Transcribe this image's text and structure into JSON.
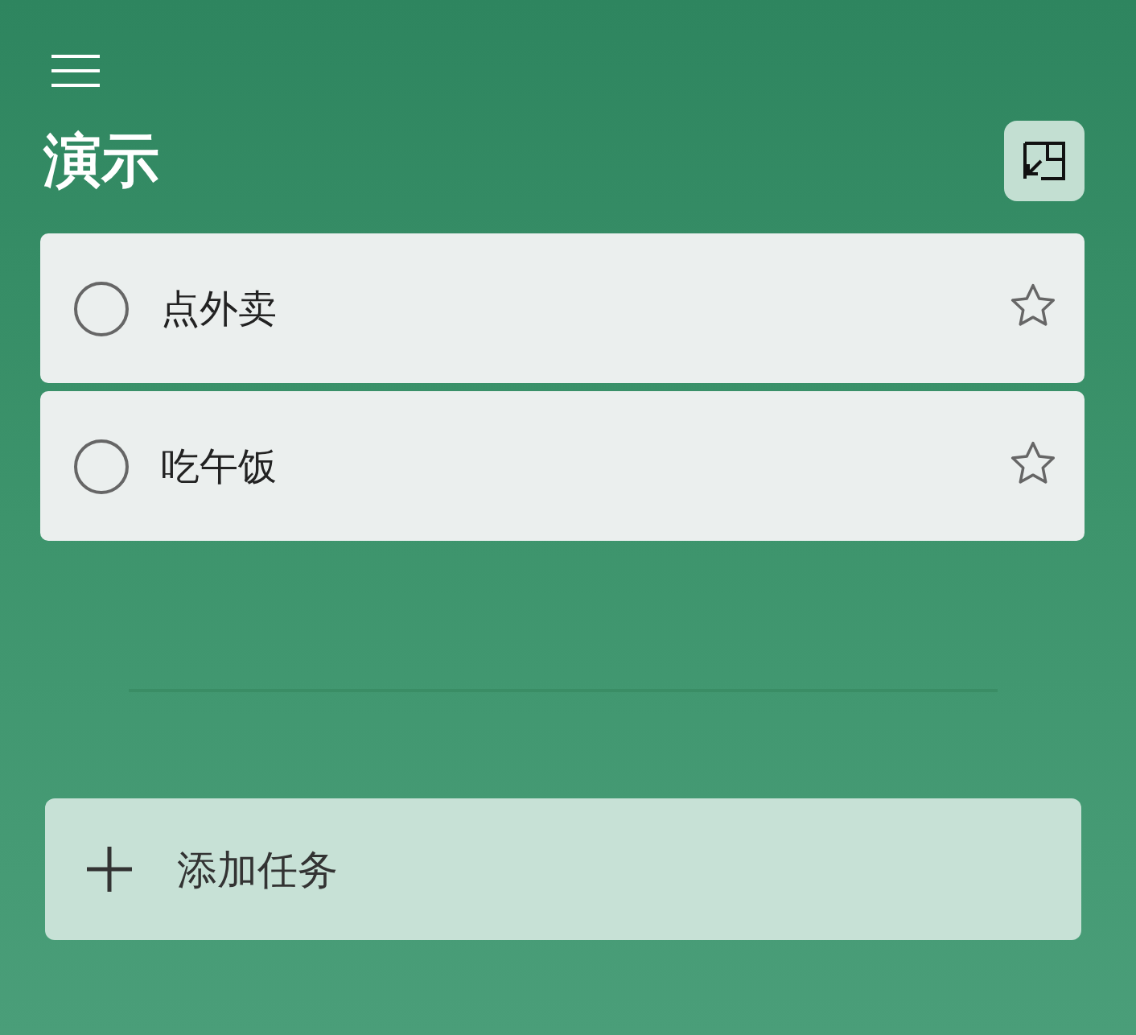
{
  "list": {
    "title": "演示"
  },
  "tasks": [
    {
      "title": "点外卖",
      "completed": false,
      "important": false
    },
    {
      "title": "吃午饭",
      "completed": false,
      "important": false
    }
  ],
  "add_task": {
    "label": "添加任务"
  }
}
